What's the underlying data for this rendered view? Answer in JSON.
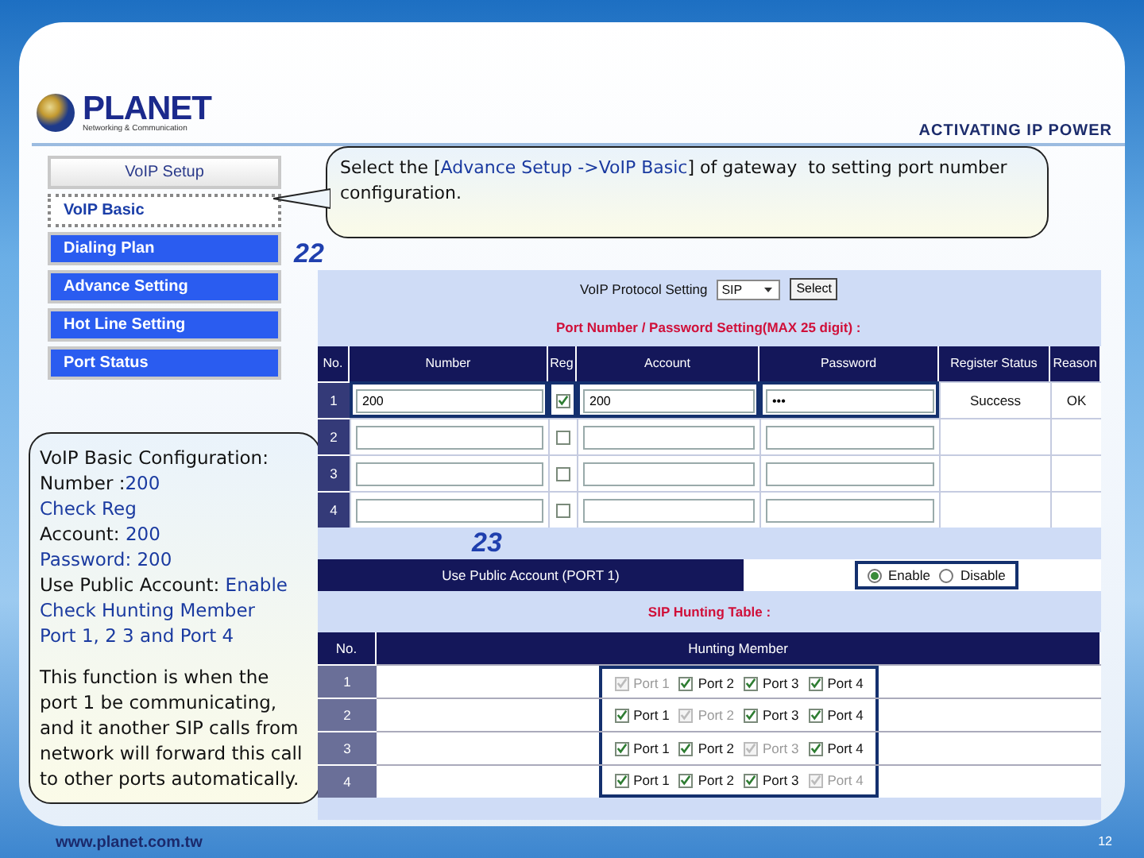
{
  "header": {
    "brand": "PLANET",
    "tagline": "Networking & Communication",
    "slogan": "ACTIVATING IP POWER"
  },
  "nav": {
    "title": "VoIP Setup",
    "items": [
      {
        "label": "VoIP Basic",
        "selected": true
      },
      {
        "label": "Dialing Plan",
        "selected": false
      },
      {
        "label": "Advance Setting",
        "selected": false
      },
      {
        "label": "Hot Line Setting",
        "selected": false
      },
      {
        "label": "Port Status",
        "selected": false
      }
    ]
  },
  "callout": {
    "segments": [
      {
        "text": "Select the [",
        "highlight": false
      },
      {
        "text": "Advance Setup ->VoIP Basic",
        "highlight": true
      },
      {
        "text": "] of gateway  to setting port number configuration.",
        "highlight": false
      }
    ]
  },
  "step_a": "22",
  "step_b": "23",
  "note": {
    "lines": [
      {
        "segments": [
          {
            "text": "VoIP Basic Configuration:",
            "highlight": false
          }
        ]
      },
      {
        "segments": [
          {
            "text": "Number :",
            "highlight": false
          },
          {
            "text": "200",
            "highlight": true
          }
        ]
      },
      {
        "segments": [
          {
            "text": "Check Reg",
            "highlight": true
          }
        ]
      },
      {
        "segments": [
          {
            "text": "Account: ",
            "highlight": false
          },
          {
            "text": "200",
            "highlight": true
          }
        ]
      },
      {
        "segments": [
          {
            "text": "Password: 200",
            "highlight": true
          }
        ]
      },
      {
        "segments": [
          {
            "text": "Use Public Account: ",
            "highlight": false
          },
          {
            "text": "Enable",
            "highlight": true
          }
        ]
      },
      {
        "segments": [
          {
            "text": "Check Hunting Member",
            "highlight": true
          }
        ]
      },
      {
        "segments": [
          {
            "text": "Port 1, 2 3 and Port 4",
            "highlight": true
          }
        ]
      }
    ],
    "paragraph": "This function is when the port 1 be communicating, and it another SIP calls from network will forward this call to other ports automatically."
  },
  "panel": {
    "protocol_label": "VoIP Protocol Setting",
    "protocol_value": "SIP",
    "select_button": "Select",
    "ports_title": "Port Number / Password Setting(MAX 25 digit) :",
    "ports_columns": [
      "No.",
      "Number",
      "Reg",
      "Account",
      "Password",
      "Register Status",
      "Reason"
    ],
    "ports_rows": [
      {
        "no": "1",
        "number": "200",
        "reg": true,
        "account": "200",
        "password": "•••",
        "status": "Success",
        "reason": "OK",
        "highlighted": true
      },
      {
        "no": "2",
        "reg": false,
        "highlighted": false
      },
      {
        "no": "3",
        "reg": false,
        "highlighted": false
      },
      {
        "no": "4",
        "reg": false,
        "highlighted": false
      }
    ],
    "public_account": {
      "label": "Use Public Account (PORT 1)",
      "outlined": true,
      "options": [
        {
          "label": "Enable",
          "selected": true
        },
        {
          "label": "Disable",
          "selected": false
        }
      ]
    },
    "hunting_title": "SIP Hunting Table :",
    "hunting_columns": [
      "No.",
      "Hunting Member"
    ],
    "hunting_outlined": true,
    "hunting_rows": [
      {
        "no": "1",
        "members": [
          {
            "label": "Port 1",
            "checked": true,
            "disabled": true
          },
          {
            "label": "Port 2",
            "checked": true,
            "disabled": false
          },
          {
            "label": "Port 3",
            "checked": true,
            "disabled": false
          },
          {
            "label": "Port 4",
            "checked": true,
            "disabled": false
          }
        ]
      },
      {
        "no": "2",
        "members": [
          {
            "label": "Port 1",
            "checked": true,
            "disabled": false
          },
          {
            "label": "Port 2",
            "checked": true,
            "disabled": true
          },
          {
            "label": "Port 3",
            "checked": true,
            "disabled": false
          },
          {
            "label": "Port 4",
            "checked": true,
            "disabled": false
          }
        ]
      },
      {
        "no": "3",
        "members": [
          {
            "label": "Port 1",
            "checked": true,
            "disabled": false
          },
          {
            "label": "Port 2",
            "checked": true,
            "disabled": false
          },
          {
            "label": "Port 3",
            "checked": true,
            "disabled": true
          },
          {
            "label": "Port 4",
            "checked": true,
            "disabled": false
          }
        ]
      },
      {
        "no": "4",
        "members": [
          {
            "label": "Port 1",
            "checked": true,
            "disabled": false
          },
          {
            "label": "Port 2",
            "checked": true,
            "disabled": false
          },
          {
            "label": "Port 3",
            "checked": true,
            "disabled": false
          },
          {
            "label": "Port 4",
            "checked": true,
            "disabled": true
          }
        ]
      }
    ]
  },
  "footer": {
    "url": "www.planet.com.tw",
    "page": "12"
  }
}
